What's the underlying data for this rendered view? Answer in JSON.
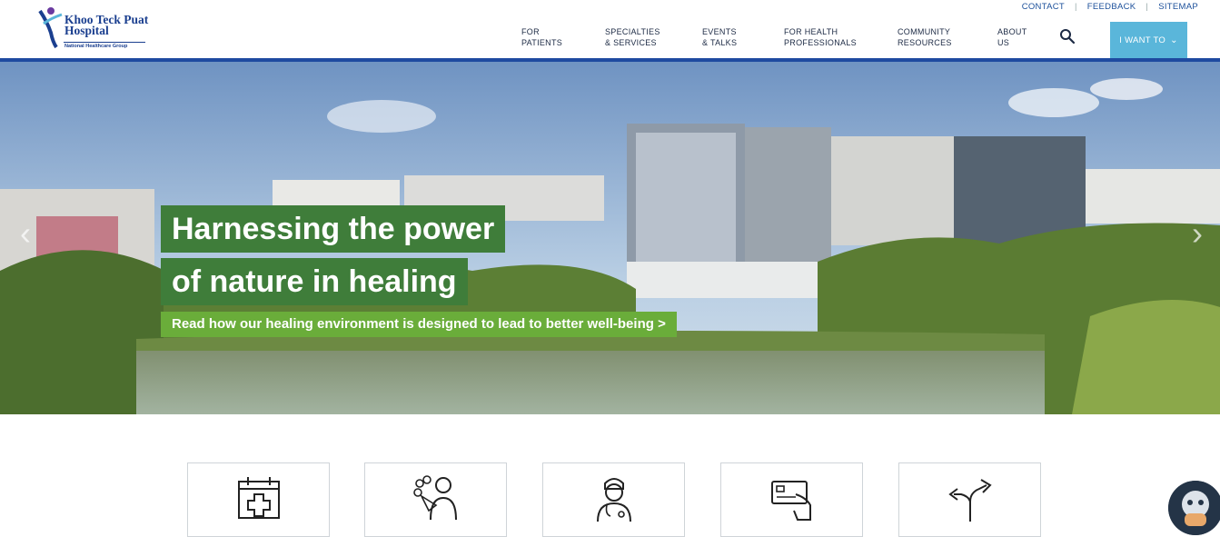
{
  "logo": {
    "name": "Khoo Teck Puat Hospital",
    "group": "National Healthcare Group"
  },
  "utility_nav": [
    "CONTACT",
    "FEEDBACK",
    "SITEMAP"
  ],
  "main_nav": [
    {
      "line1": "FOR",
      "line2": "PATIENTS"
    },
    {
      "line1": "SPECIALTIES",
      "line2": "& SERVICES"
    },
    {
      "line1": "EVENTS",
      "line2": "& TALKS"
    },
    {
      "line1": "FOR HEALTH",
      "line2": "PROFESSIONALS"
    },
    {
      "line1": "COMMUNITY",
      "line2": "RESOURCES"
    },
    {
      "line1": "ABOUT",
      "line2": "US"
    }
  ],
  "i_want_to": "I WANT TO",
  "hero": {
    "headline_line1": "Harnessing the power",
    "headline_line2": "of nature in healing",
    "cta": "Read how our healing environment is designed to lead to better well-being >"
  },
  "quick_links": [
    {
      "icon": "calendar-plus-icon"
    },
    {
      "icon": "visitor-flowers-icon"
    },
    {
      "icon": "doctor-icon"
    },
    {
      "icon": "payment-card-icon"
    },
    {
      "icon": "directions-icon"
    }
  ],
  "colors": {
    "brand_blue": "#1e4aa0",
    "accent_cyan": "#5ab6da",
    "hero_green": "#3f7d3a",
    "cta_green": "#6aad3a"
  }
}
